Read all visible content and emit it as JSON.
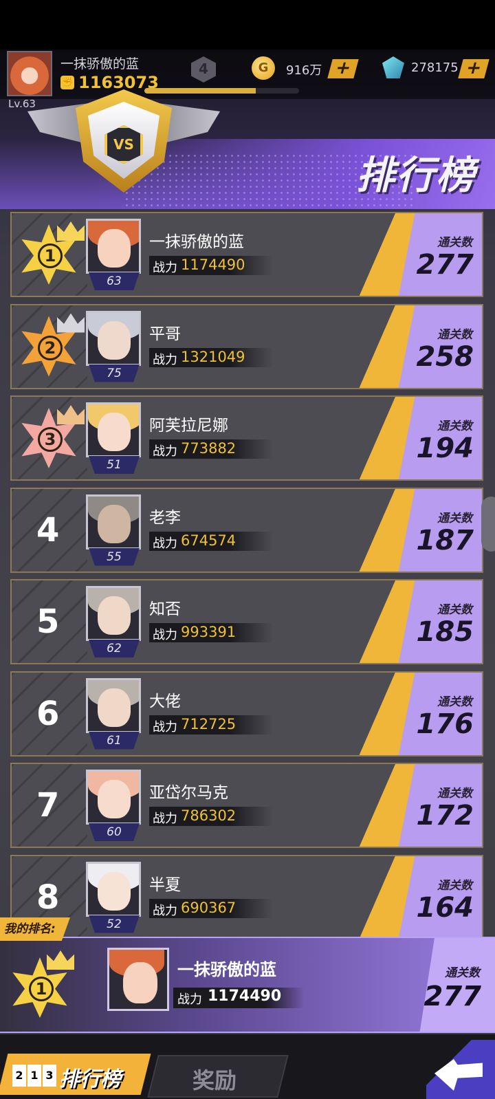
{
  "player": {
    "name": "一抹骄傲的蓝",
    "level_label": "Lv.63",
    "power": "1163073",
    "vip": "4",
    "exp_fraction": 0.72
  },
  "currency": {
    "coins_icon": "coin-icon",
    "coins_letter": "G",
    "coins": "916万",
    "gems_icon": "gem-icon",
    "gems": "278175",
    "plus": "+"
  },
  "header": {
    "title": "排行榜",
    "emblem_text": "VS"
  },
  "labels": {
    "clears": "通关数",
    "power": "战力"
  },
  "rankings": [
    {
      "rank": "1",
      "name": "一抹骄傲的蓝",
      "level": "63",
      "power": "1174490",
      "clears": "277",
      "hair": "#d9683a",
      "skin": "#f6d2bf",
      "medal": "gold"
    },
    {
      "rank": "2",
      "name": "平哥",
      "level": "75",
      "power": "1321049",
      "clears": "258",
      "hair": "#c9ccd6",
      "skin": "#efd9cc",
      "medal": "orange"
    },
    {
      "rank": "3",
      "name": "阿芙拉尼娜",
      "level": "51",
      "power": "773882",
      "clears": "194",
      "hair": "#f1c86a",
      "skin": "#f7dccd",
      "medal": "pink"
    },
    {
      "rank": "4",
      "name": "老李",
      "level": "55",
      "power": "674574",
      "clears": "187",
      "hair": "#8f8a86",
      "skin": "#cfb6a2",
      "medal": "none"
    },
    {
      "rank": "5",
      "name": "知否",
      "level": "62",
      "power": "993391",
      "clears": "185",
      "hair": "#b8b2aa",
      "skin": "#f0d8c8",
      "medal": "none"
    },
    {
      "rank": "6",
      "name": "大佬",
      "level": "61",
      "power": "712725",
      "clears": "176",
      "hair": "#b8b2aa",
      "skin": "#f0d8c8",
      "medal": "none"
    },
    {
      "rank": "7",
      "name": "亚岱尔马克",
      "level": "60",
      "power": "786302",
      "clears": "172",
      "hair": "#f0b8a0",
      "skin": "#f7dccd",
      "medal": "none"
    },
    {
      "rank": "8",
      "name": "半夏",
      "level": "52",
      "power": "690367",
      "clears": "164",
      "hair": "#eeeef2",
      "skin": "#f7e2d6",
      "medal": "none"
    }
  ],
  "my_rank": {
    "tag": "我的排名:",
    "rank": "1",
    "name": "一抹骄傲的蓝",
    "power": "1174490",
    "clears": "277"
  },
  "tabs": {
    "ranking_icon": [
      "2",
      "1",
      "3"
    ],
    "ranking": "排行榜",
    "reward": "奖励"
  }
}
